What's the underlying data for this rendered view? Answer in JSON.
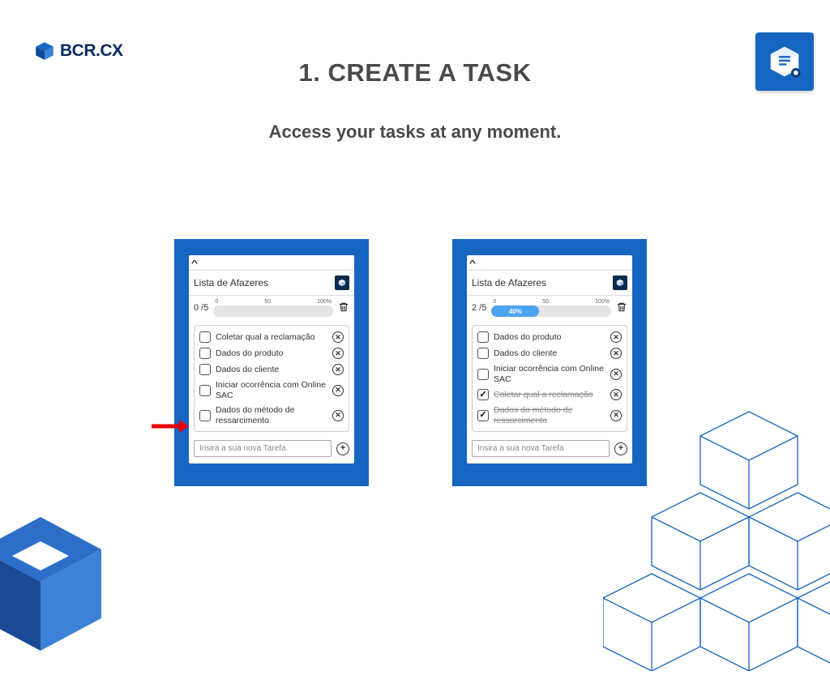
{
  "brand": {
    "text": "BCR.CX"
  },
  "title": "1. CREATE A TASK",
  "subtitle": "Access your tasks at any moment.",
  "ticks": {
    "t0": "0",
    "t50": "50",
    "t100": "100%"
  },
  "input_placeholder": "Insira a sua nova Tarefa",
  "panel_a": {
    "title": "Lista de Afazeres",
    "count": "0 /5",
    "fill_pct": 0,
    "fill_label": "",
    "tasks": [
      {
        "text": "Coletar qual a reclamação",
        "done": false
      },
      {
        "text": "Dados do produto",
        "done": false
      },
      {
        "text": "Dados do cliente",
        "done": false
      },
      {
        "text": "Iniciar ocorrência com Online SAC",
        "done": false
      },
      {
        "text": "Dados do método de ressarcimento",
        "done": false
      }
    ]
  },
  "panel_b": {
    "title": "Lista de Afazeres",
    "count": "2 /5",
    "fill_pct": 40,
    "fill_label": "40%",
    "tasks": [
      {
        "text": "Dados do produto",
        "done": false
      },
      {
        "text": "Dados do cliente",
        "done": false
      },
      {
        "text": "Iniciar ocorrência com Online SAC",
        "done": false
      },
      {
        "text": "Coletar qual a reclamação",
        "done": true
      },
      {
        "text": "Dados do método de ressarcimento",
        "done": true
      }
    ]
  }
}
